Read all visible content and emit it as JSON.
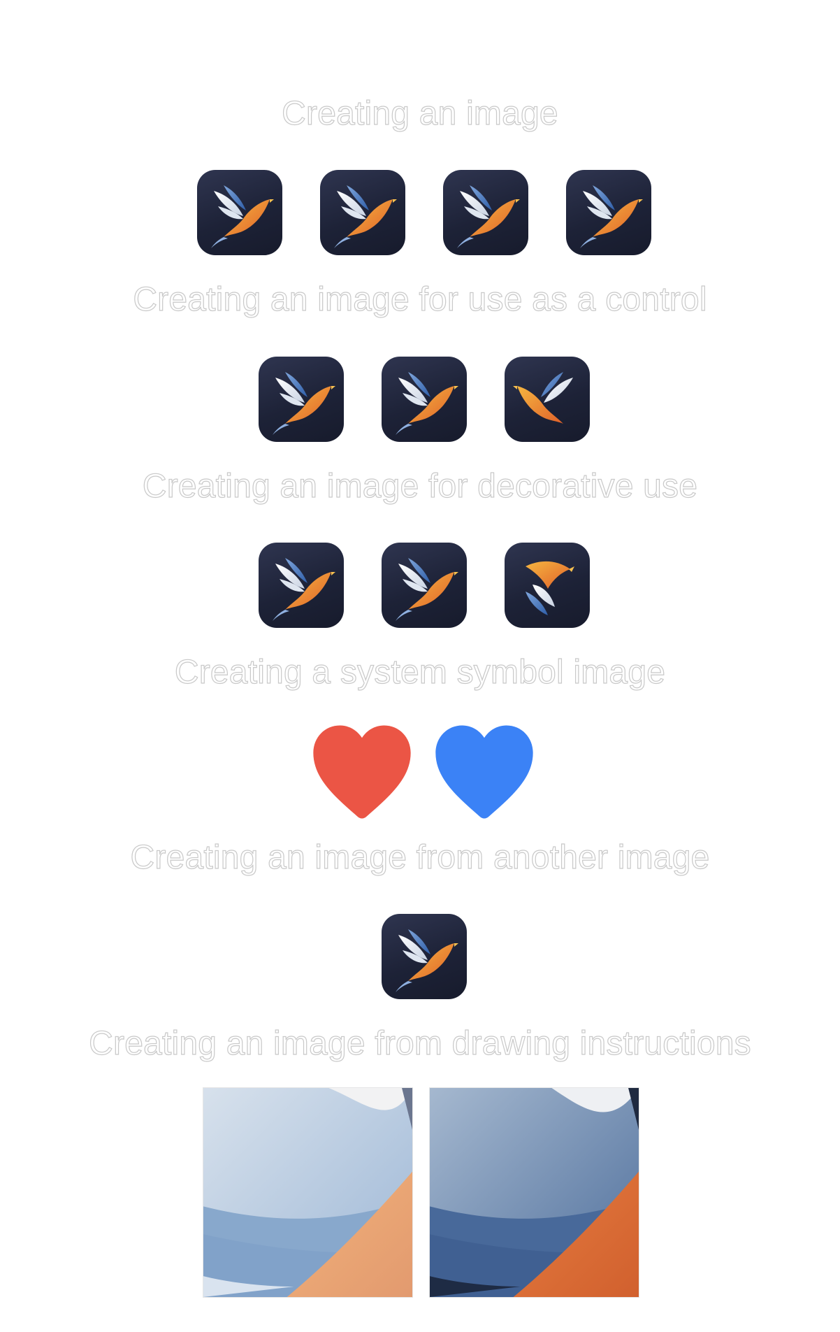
{
  "sections": [
    {
      "title": "Creating an image",
      "icon_count": 4
    },
    {
      "title": "Creating an image for use as a control",
      "icon_count": 3
    },
    {
      "title": "Creating an image for decorative use",
      "icon_count": 3
    },
    {
      "title": "Creating a system symbol image",
      "symbols": [
        {
          "name": "heart-fill",
          "color": "#EB5545"
        },
        {
          "name": "heart-fill",
          "color": "#3B82F6"
        }
      ]
    },
    {
      "title": "Creating an image from another image",
      "icon_count": 1
    },
    {
      "title": "Creating an image from drawing instructions",
      "tiles": 2
    }
  ],
  "colors": {
    "icon_bg": "#1D2237",
    "bird_orange": "#F08A2A",
    "bird_blue": "#3D6FB8",
    "heart_red": "#EB5545",
    "heart_blue": "#3B82F6"
  }
}
